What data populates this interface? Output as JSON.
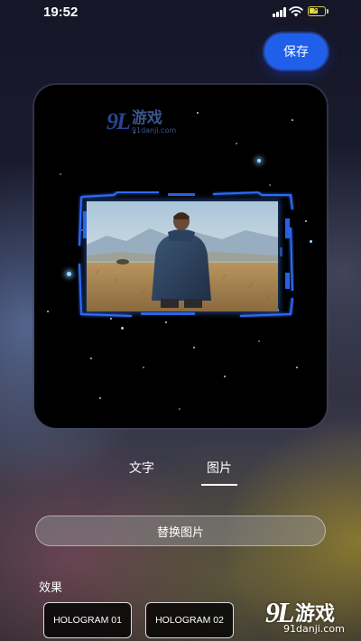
{
  "status_bar": {
    "time": "19:52"
  },
  "header": {
    "save_label": "保存"
  },
  "preview": {
    "watermark_logo": "9L",
    "watermark_title": "游戏",
    "watermark_url": "91danji.com"
  },
  "tabs": [
    {
      "label": "文字",
      "active": false
    },
    {
      "label": "图片",
      "active": true
    }
  ],
  "replace_button_label": "替换图片",
  "effects": {
    "label": "效果",
    "items": [
      {
        "label": "HOLOGRAM 01"
      },
      {
        "label": "HOLOGRAM 02"
      }
    ]
  },
  "watermark": {
    "logo": "9L",
    "title": "游戏",
    "url": "91danji.com"
  },
  "colors": {
    "accent": "#1f5fea",
    "hologram_blue": "#2d6cff"
  }
}
